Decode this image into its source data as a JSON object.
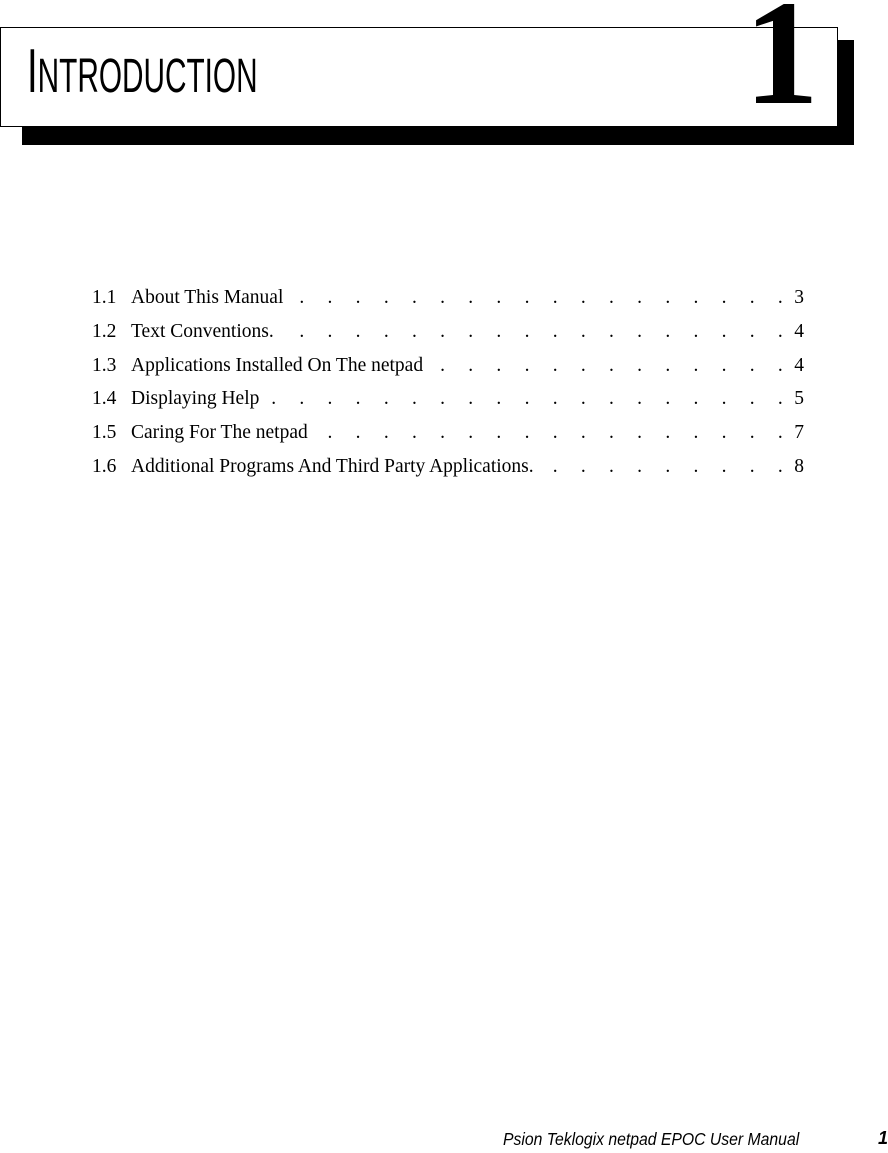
{
  "chapter": {
    "title_first": "I",
    "title_rest": "NTRODUCTION",
    "number": "1"
  },
  "toc": [
    {
      "num": "1.1",
      "title": "About This Manual",
      "page": "3"
    },
    {
      "num": "1.2",
      "title": "Text Conventions.",
      "page": "4"
    },
    {
      "num": "1.3",
      "title": "Applications Installed On The netpad",
      "page": "4"
    },
    {
      "num": "1.4",
      "title": "Displaying Help",
      "page": "5"
    },
    {
      "num": "1.5",
      "title": "Caring For The netpad",
      "page": "7"
    },
    {
      "num": "1.6",
      "title": "Additional Programs And Third Party Applications.",
      "page": "8"
    }
  ],
  "toc_leader": ". . . . . . . . . . . . . . . . . . . . . . . . . . . . . . . . . . . . . . . . . . . . . . . . .",
  "footer": {
    "manual_title": "Psion Teklogix netpad EPOC User Manual",
    "page_number": "1"
  }
}
